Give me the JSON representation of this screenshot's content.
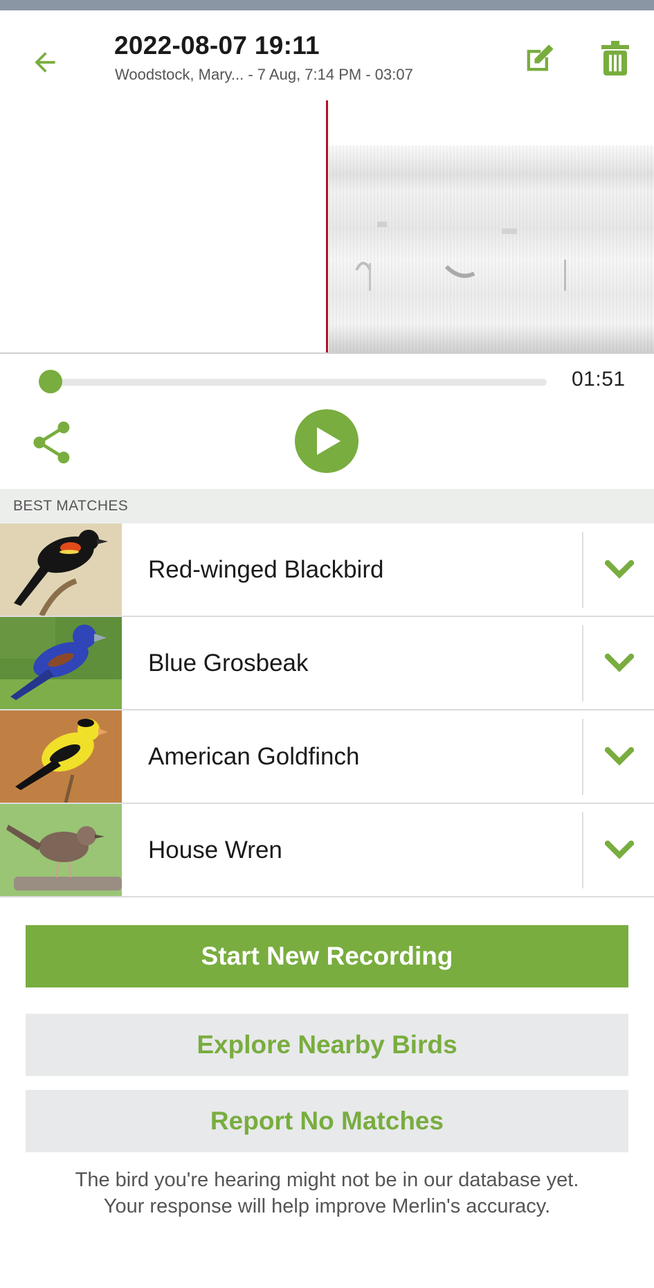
{
  "header": {
    "title": "2022-08-07 19:11",
    "subtitle": "Woodstock, Mary... - 7 Aug, 7:14 PM - 03:07",
    "back_icon": "arrow-left-icon",
    "edit_icon": "edit-icon",
    "delete_icon": "trash-icon"
  },
  "player": {
    "playback_progress": 0.0,
    "time": "01:51",
    "share_icon": "share-icon",
    "play_icon": "play-icon"
  },
  "matches": {
    "section_label": "BEST MATCHES",
    "items": [
      {
        "name": "Red-winged Blackbird",
        "photo": "red-winged-blackbird-photo",
        "expand_icon": "chevron-down-icon"
      },
      {
        "name": "Blue Grosbeak",
        "photo": "blue-grosbeak-photo",
        "expand_icon": "chevron-down-icon"
      },
      {
        "name": "American Goldfinch",
        "photo": "american-goldfinch-photo",
        "expand_icon": "chevron-down-icon"
      },
      {
        "name": "House Wren",
        "photo": "house-wren-photo",
        "expand_icon": "chevron-down-icon"
      }
    ]
  },
  "actions": {
    "start_new": "Start New Recording",
    "explore": "Explore Nearby Birds",
    "report": "Report No Matches"
  },
  "footer": {
    "note_line1": "The bird you're hearing might not be in our database yet.",
    "note_line2": "Your response will help improve Merlin's accuracy."
  },
  "colors": {
    "accent": "#79ad3f",
    "playhead": "#b0102a",
    "section_bg": "#eceeec",
    "secondary_button_bg": "#e8e9eb"
  }
}
